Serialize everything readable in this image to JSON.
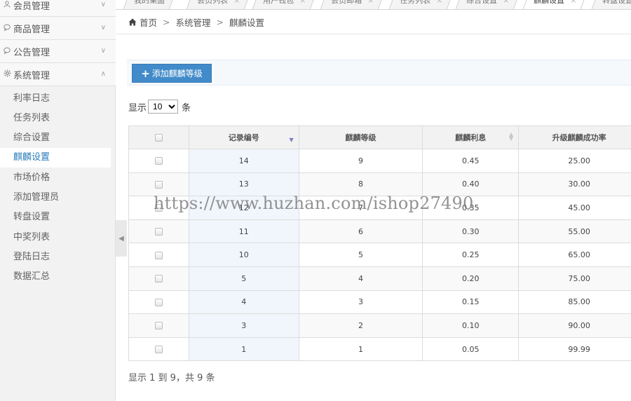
{
  "sidebar": {
    "groups": [
      {
        "label": "会员管理",
        "icon": "user-icon"
      },
      {
        "label": "商品管理",
        "icon": "chat-icon"
      },
      {
        "label": "公告管理",
        "icon": "chat-icon"
      },
      {
        "label": "系统管理",
        "icon": "gear-icon"
      }
    ],
    "items": [
      {
        "label": "利率日志"
      },
      {
        "label": "任务列表"
      },
      {
        "label": "综合设置"
      },
      {
        "label": "麒麟设置",
        "active": true
      },
      {
        "label": "市场价格"
      },
      {
        "label": "添加管理员"
      },
      {
        "label": "转盘设置"
      },
      {
        "label": "中奖列表"
      },
      {
        "label": "登陆日志"
      },
      {
        "label": "数据汇总"
      }
    ]
  },
  "tabs": [
    {
      "label": "我的桌面"
    },
    {
      "label": "会员列表"
    },
    {
      "label": "用户钱包"
    },
    {
      "label": "会员邮箱"
    },
    {
      "label": "任务列表"
    },
    {
      "label": "综合设置"
    },
    {
      "label": "麒麟设置",
      "active": true
    },
    {
      "label": "转盘设置"
    }
  ],
  "breadcrumb": {
    "home": "首页",
    "sep": ">",
    "level1": "系统管理",
    "level2": "麒麟设置"
  },
  "toolbar": {
    "add_label": "添加麒麟等级"
  },
  "length_menu": {
    "prefix": "显示",
    "value": "10",
    "suffix": "条"
  },
  "table": {
    "headers": [
      "记录编号",
      "麒麟等级",
      "麒麟利息",
      "升级麒麟成功率"
    ],
    "rows": [
      [
        "14",
        "9",
        "0.45",
        "25.00"
      ],
      [
        "13",
        "8",
        "0.40",
        "30.00"
      ],
      [
        "12",
        "7",
        "0.35",
        "45.00"
      ],
      [
        "11",
        "6",
        "0.30",
        "55.00"
      ],
      [
        "10",
        "5",
        "0.25",
        "65.00"
      ],
      [
        "5",
        "4",
        "0.20",
        "75.00"
      ],
      [
        "4",
        "3",
        "0.15",
        "85.00"
      ],
      [
        "3",
        "2",
        "0.10",
        "90.00"
      ],
      [
        "1",
        "1",
        "0.05",
        "99.99"
      ]
    ]
  },
  "info": "显示 1 到 9，共 9 条",
  "watermark": "https://www.huzhan.com/ishop27490",
  "colors": {
    "accent": "#428bca",
    "active_link": "#2b7dbc"
  }
}
